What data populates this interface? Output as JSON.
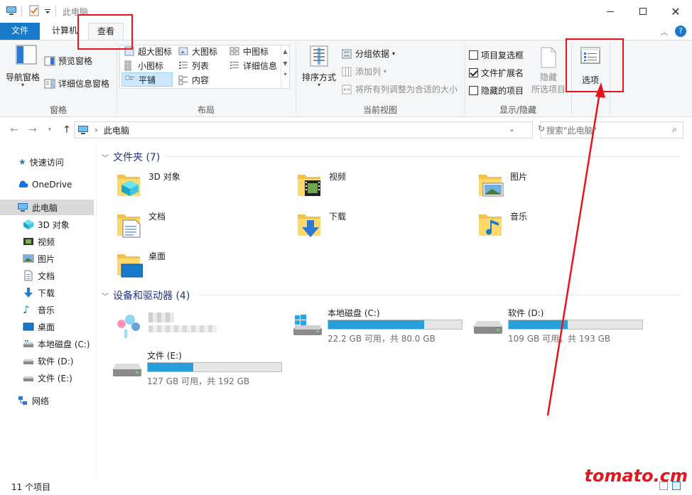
{
  "window": {
    "title": "此电脑"
  },
  "tabs": [
    {
      "label": "文件"
    },
    {
      "label": "计算机"
    },
    {
      "label": "查看"
    }
  ],
  "ribbon": {
    "pane": {
      "nav_pane": "导航窗格",
      "preview_pane": "预览窗格",
      "details_pane": "详细信息窗格",
      "label": "窗格"
    },
    "layout": {
      "items": [
        "超大图标",
        "大图标",
        "中图标",
        "小图标",
        "列表",
        "详细信息",
        "平铺",
        "内容"
      ],
      "selected": "平铺",
      "label": "布局"
    },
    "current_view": {
      "sort": "排序方式",
      "group_by": "分组依据",
      "add_columns": "添加列",
      "fit_columns": "将所有列调整为合适的大小",
      "label": "当前视图"
    },
    "show_hide": {
      "item_checkboxes": "项目复选框",
      "item_checkboxes_checked": false,
      "file_ext": "文件扩展名",
      "file_ext_checked": true,
      "hidden_items": "隐藏的项目",
      "hidden_items_checked": false,
      "hide_selected": "隐藏",
      "hide_selected_2": "所选项目",
      "label": "显示/隐藏"
    },
    "options": {
      "label": "选项"
    }
  },
  "address": {
    "path": "此电脑",
    "search_placeholder": "搜索\"此电脑\""
  },
  "sidebar": {
    "items": [
      {
        "label": "快速访问",
        "icon": "star-icon"
      },
      {
        "label": "OneDrive",
        "icon": "cloud-icon"
      },
      {
        "label": "此电脑",
        "icon": "computer-icon"
      },
      {
        "label": "3D 对象",
        "icon": "cube-icon"
      },
      {
        "label": "视频",
        "icon": "video-icon"
      },
      {
        "label": "图片",
        "icon": "picture-icon"
      },
      {
        "label": "文档",
        "icon": "document-icon"
      },
      {
        "label": "下载",
        "icon": "download-icon"
      },
      {
        "label": "音乐",
        "icon": "music-icon"
      },
      {
        "label": "桌面",
        "icon": "desktop-icon"
      },
      {
        "label": "本地磁盘 (C:)",
        "icon": "drive-icon"
      },
      {
        "label": "软件 (D:)",
        "icon": "drive-icon"
      },
      {
        "label": "文件 (E:)",
        "icon": "drive-icon"
      },
      {
        "label": "网络",
        "icon": "network-icon"
      }
    ]
  },
  "folders": {
    "header": "文件夹 (7)",
    "items": [
      {
        "label": "3D 对象"
      },
      {
        "label": "视频"
      },
      {
        "label": "图片"
      },
      {
        "label": "文档"
      },
      {
        "label": "下载"
      },
      {
        "label": "音乐"
      },
      {
        "label": "桌面"
      }
    ]
  },
  "devices": {
    "header": "设备和驱动器 (4)",
    "drives": [
      {
        "label": "本地磁盘 (C:)",
        "info": "22.2 GB 可用，共 80.0 GB",
        "used_fraction": 0.72
      },
      {
        "label": "软件 (D:)",
        "info": "109 GB 可用，共 193 GB",
        "used_fraction": 0.44
      },
      {
        "label": "文件 (E:)",
        "info": "127 GB 可用，共 192 GB",
        "used_fraction": 0.34
      }
    ]
  },
  "status": {
    "count": "11 个项目"
  },
  "watermark": "tomato.cm",
  "colors": {
    "accent": "#1979ca",
    "bar_fill": "#26a0da",
    "annotation": "#e8141b"
  }
}
